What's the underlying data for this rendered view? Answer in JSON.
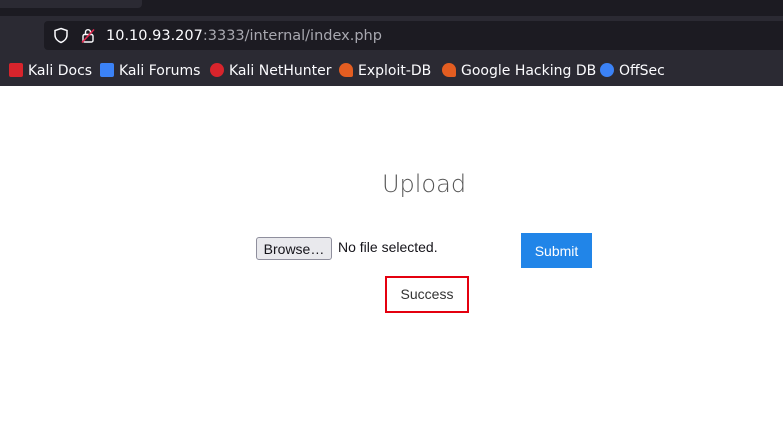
{
  "browser": {
    "url_host": "10.10.93.207",
    "url_rest": ":3333/internal/index.php",
    "bookmarks": [
      {
        "label": "Kali Docs",
        "icon": "kali-docs-icon",
        "color": "#d8242c"
      },
      {
        "label": "Kali Forums",
        "icon": "kali-forums-icon",
        "color": "#3b82f6"
      },
      {
        "label": "Kali NetHunter",
        "icon": "kali-nethunter-icon",
        "color": "#d8242c"
      },
      {
        "label": "Exploit-DB",
        "icon": "exploit-db-icon",
        "color": "#e35d21"
      },
      {
        "label": "Google Hacking DB",
        "icon": "ghdb-icon",
        "color": "#e35d21"
      },
      {
        "label": "OffSec",
        "icon": "offsec-icon",
        "color": "#3b82f6"
      }
    ]
  },
  "page": {
    "heading": "Upload",
    "browse_label": "Browse…",
    "file_status": "No file selected.",
    "submit_label": "Submit",
    "result_message": "Success"
  },
  "colors": {
    "submit_bg": "#2185e8",
    "highlight_border": "#e4000f"
  }
}
